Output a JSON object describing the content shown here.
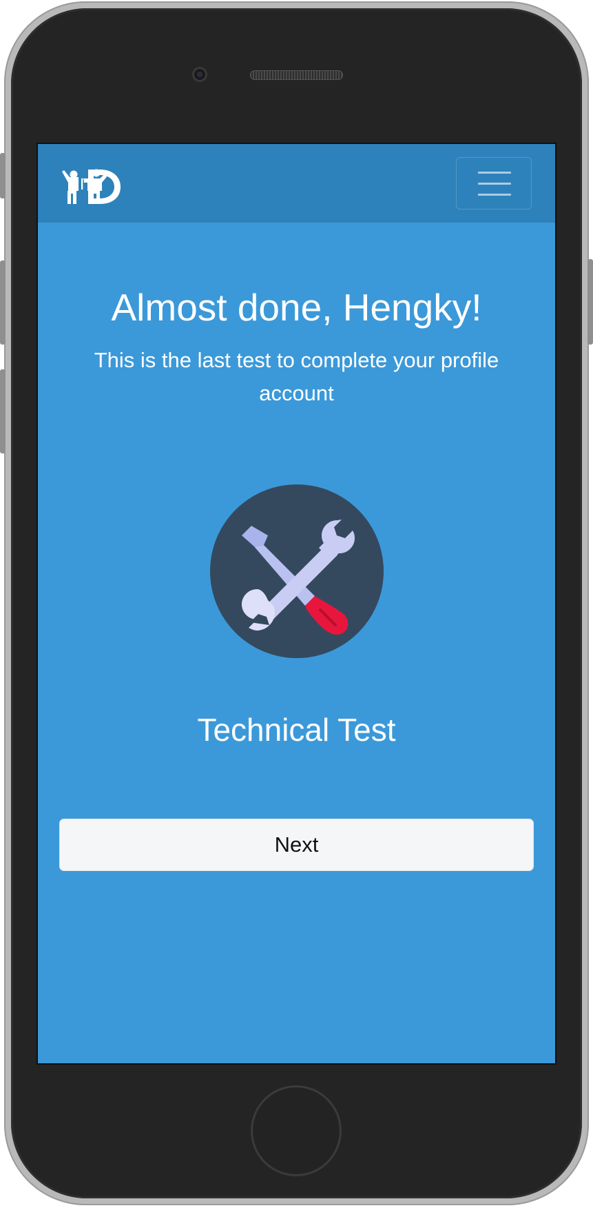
{
  "header": {
    "logo": "hd-logo",
    "menu_icon": "hamburger-menu-icon"
  },
  "main": {
    "headline": "Almost done, Hengky!",
    "subtitle": "This is the last test to complete your profile account",
    "test_icon": "wrench-screwdriver-icon",
    "test_name": "Technical Test",
    "next_label": "Next"
  },
  "colors": {
    "screen_background": "#3b99d9",
    "navbar_background": "#2e82bb",
    "icon_circle": "#34495e",
    "screwdriver_handle": "#e8163d",
    "button_background": "#f5f6f8"
  }
}
